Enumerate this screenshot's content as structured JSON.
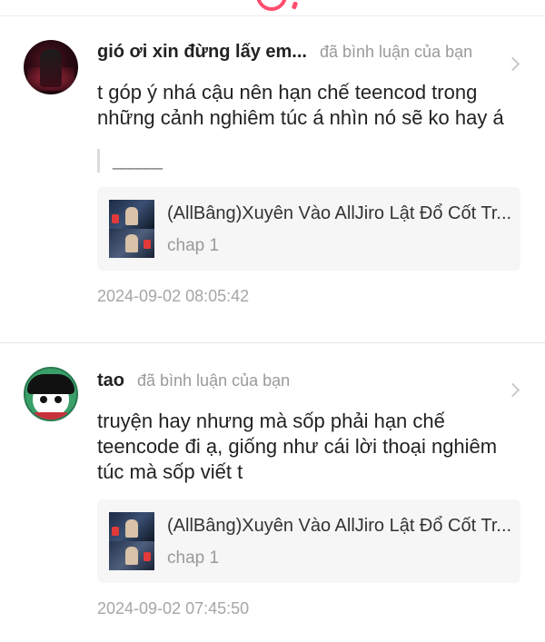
{
  "comments": [
    {
      "username": "gió ơi xin đừng lấy em...",
      "action": "đã bình luận của bạn",
      "text": "t góp ý nhá cậu nên hạn chế teencod trong những cảnh nghiêm túc á nhìn nó sẽ ko hay á",
      "quote": "______",
      "story": {
        "title": "(AllBâng)Xuyên Vào AllJiro Lật Đổ Cốt Tr...",
        "chapter": "chap 1"
      },
      "time": "2024-09-02 08:05:42"
    },
    {
      "username": "tao",
      "action": "đã bình luận của bạn",
      "text": "truyện hay nhưng mà sốp phải hạn chế teencode đi ạ, giống như cái lời thoại nghiêm túc mà sốp viết t",
      "story": {
        "title": "(AllBâng)Xuyên Vào AllJiro Lật Đổ Cốt Tr...",
        "chapter": "chap 1"
      },
      "time": "2024-09-02 07:45:50"
    }
  ],
  "colors": {
    "accent": "#ff4d6d",
    "muted": "#9a9a9a",
    "card_bg": "#f6f6f6"
  },
  "icons": {
    "header": "smile-logo-icon",
    "open": "chevron-right-icon"
  }
}
